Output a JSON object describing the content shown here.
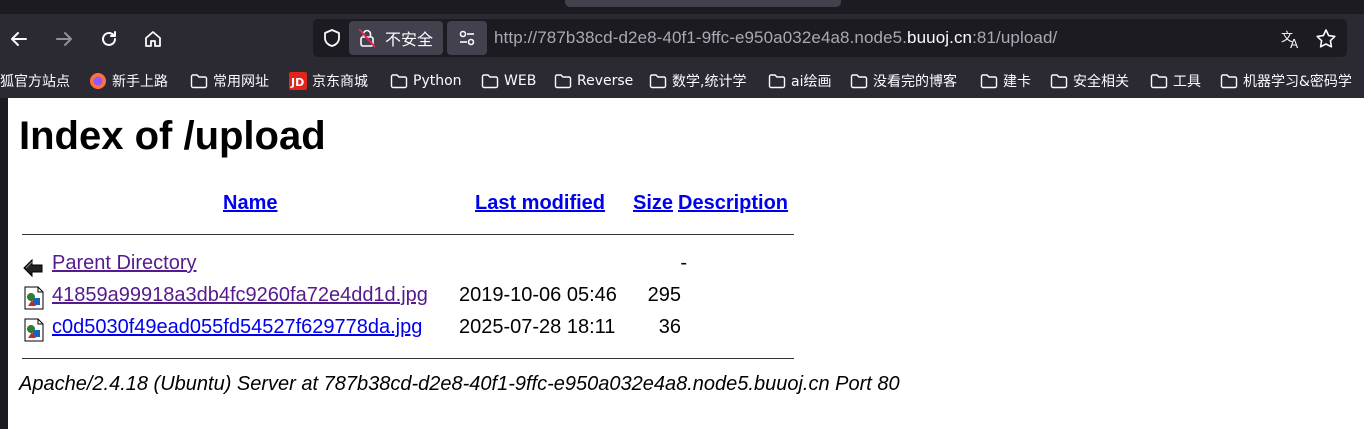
{
  "browser": {
    "security_label": "不安全",
    "url": {
      "prefix": "http://787b38cd-d2e8-40f1-9ffc-e950a032e4a8.node5.",
      "domain": "buuoj.cn",
      "suffix": ":81/upload/"
    },
    "nav_icons": [
      "back-icon",
      "forward-icon",
      "reload-icon",
      "home-icon"
    ],
    "right_icons": [
      "translate-icon",
      "bookmark-star-icon"
    ]
  },
  "bookmarks": [
    {
      "label": "狐官方站点",
      "icon": "none"
    },
    {
      "label": "新手上路",
      "icon": "firefox-icon"
    },
    {
      "label": "常用网址",
      "icon": "folder-icon"
    },
    {
      "label": "京东商城",
      "icon": "jd-icon"
    },
    {
      "label": "Python",
      "icon": "folder-icon"
    },
    {
      "label": "WEB",
      "icon": "folder-icon"
    },
    {
      "label": "Reverse",
      "icon": "folder-icon"
    },
    {
      "label": "数学,统计学",
      "icon": "folder-icon"
    },
    {
      "label": "ai绘画",
      "icon": "folder-icon"
    },
    {
      "label": "没看完的博客",
      "icon": "folder-icon"
    },
    {
      "label": "建卡",
      "icon": "folder-icon"
    },
    {
      "label": "安全相关",
      "icon": "folder-icon"
    },
    {
      "label": "工具",
      "icon": "folder-icon"
    },
    {
      "label": "机器学习&密码学",
      "icon": "folder-icon"
    }
  ],
  "page": {
    "title": "Index of /upload",
    "columns": {
      "name": "Name",
      "last_modified": "Last modified",
      "size": "Size",
      "description": "Description"
    },
    "rows": [
      {
        "name": "Parent Directory",
        "date": "",
        "size": "-",
        "icon": "back-arrow-icon",
        "visited": true
      },
      {
        "name": "41859a99918a3db4fc9260fa72e4dd1d.jpg",
        "date": "2019-10-06 05:46",
        "size": "295",
        "icon": "image-file-icon",
        "visited": true
      },
      {
        "name": "c0d5030f49ead055fd54527f629778da.jpg",
        "date": "2025-07-28 18:11",
        "size": "36",
        "icon": "image-file-icon",
        "visited": false
      }
    ],
    "address": "Apache/2.4.18 (Ubuntu) Server at 787b38cd-d2e8-40f1-9ffc-e950a032e4a8.node5.buuoj.cn Port 80"
  },
  "colors": {
    "link": "#0000ee",
    "visited_link": "#551a8b",
    "toolbar_bg": "#2b2a33",
    "urlbar_bg": "#1c1b22"
  }
}
